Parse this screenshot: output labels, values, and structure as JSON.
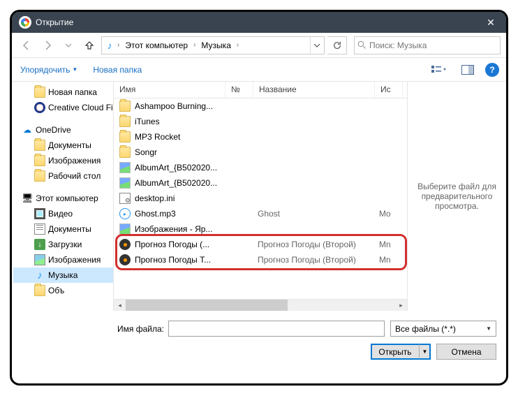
{
  "window": {
    "title": "Открытие"
  },
  "nav": {
    "breadcrumb": [
      "Этот компьютер",
      "Музыка"
    ],
    "search_placeholder": "Поиск: Музыка"
  },
  "toolbar": {
    "organize": "Упорядочить",
    "newfolder": "Новая папка"
  },
  "tree": {
    "items": [
      {
        "label": "Новая папка",
        "icon": "fold",
        "indent": true
      },
      {
        "label": "Creative Cloud Fil",
        "icon": "cc",
        "indent": true
      },
      {
        "label": "OneDrive",
        "icon": "onedrive",
        "indent": false,
        "spaceBefore": true
      },
      {
        "label": "Документы",
        "icon": "fold",
        "indent": true
      },
      {
        "label": "Изображения",
        "icon": "fold",
        "indent": true
      },
      {
        "label": "Рабочий стол",
        "icon": "fold",
        "indent": true
      },
      {
        "label": "Этот компьютер",
        "icon": "pc",
        "indent": false,
        "spaceBefore": true
      },
      {
        "label": "Видео",
        "icon": "vid",
        "indent": true
      },
      {
        "label": "Документы",
        "icon": "doc",
        "indent": true
      },
      {
        "label": "Загрузки",
        "icon": "dl",
        "indent": true
      },
      {
        "label": "Изображения",
        "icon": "img",
        "indent": true
      },
      {
        "label": "Музыка",
        "icon": "mus",
        "indent": true,
        "selected": true
      },
      {
        "label": "Объ",
        "icon": "fold",
        "indent": true
      }
    ]
  },
  "columns": {
    "name": "Имя",
    "num": "№",
    "title": "Название",
    "artist": "Ис"
  },
  "files": [
    {
      "icon": "fold",
      "name": "Ashampoo Burning..."
    },
    {
      "icon": "fold",
      "name": "iTunes"
    },
    {
      "icon": "fold",
      "name": "MP3 Rocket"
    },
    {
      "icon": "fold",
      "name": "Songr"
    },
    {
      "icon": "imgf",
      "name": "AlbumArt_{B502020..."
    },
    {
      "icon": "imgf",
      "name": "AlbumArt_{B502020..."
    },
    {
      "icon": "ini",
      "name": "desktop.ini"
    },
    {
      "icon": "mp3",
      "name": "Ghost.mp3",
      "title": "Ghost",
      "artist": "Mo"
    },
    {
      "icon": "imgf",
      "name": "Изображения - Яр..."
    },
    {
      "icon": "media",
      "name": "Прогноз Погоды (...",
      "title": "Прогноз Погоды (Второй)",
      "artist": "Mn",
      "hl": true
    },
    {
      "icon": "media",
      "name": "Прогноз Погоды Т...",
      "title": "Прогноз Погоды (Второй)",
      "artist": "Mn",
      "hl": true
    }
  ],
  "preview": "Выберите файл для предварительного просмотра.",
  "footer": {
    "filename_label": "Имя файла:",
    "filename_value": "",
    "filter": "Все файлы (*.*)",
    "open": "Открыть",
    "cancel": "Отмена"
  }
}
